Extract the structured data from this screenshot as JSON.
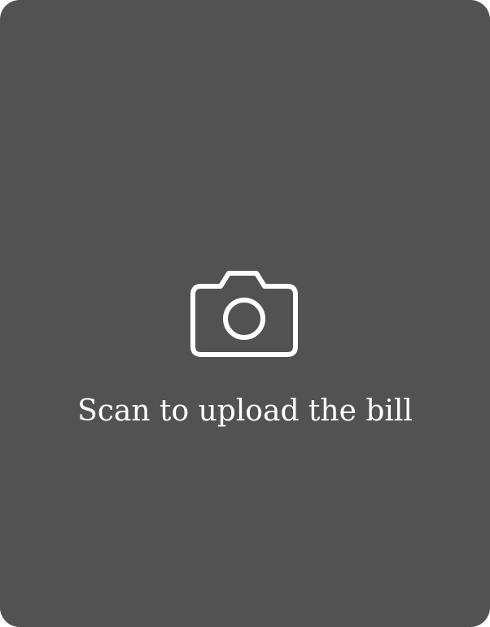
{
  "colors": {
    "card_background": "#525252",
    "foreground": "#ffffff"
  },
  "scan": {
    "icon": "camera-icon",
    "label": "Scan to upload the bill"
  }
}
